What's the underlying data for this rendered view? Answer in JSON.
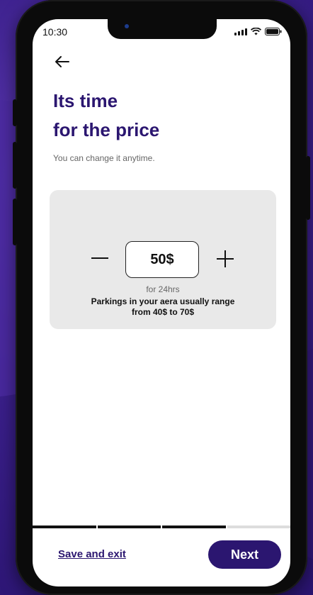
{
  "status_bar": {
    "time": "10:30"
  },
  "header": {
    "back_icon": "arrow-left-icon"
  },
  "content": {
    "title_line1": "Its time",
    "title_line2": "for the price",
    "subtitle": "You can change it anytime.",
    "price": {
      "value": "50$",
      "duration": "for 24hrs",
      "range_line1": "Parkings in your aera usually range",
      "range_line2": "from 40$ to 70$"
    }
  },
  "progress": {
    "segments_total": 4,
    "segments_completed": 3.5
  },
  "footer": {
    "save_exit_label": "Save and exit",
    "next_label": "Next"
  },
  "colors": {
    "brand": "#2b1670",
    "card_bg": "#e9e9e9"
  }
}
